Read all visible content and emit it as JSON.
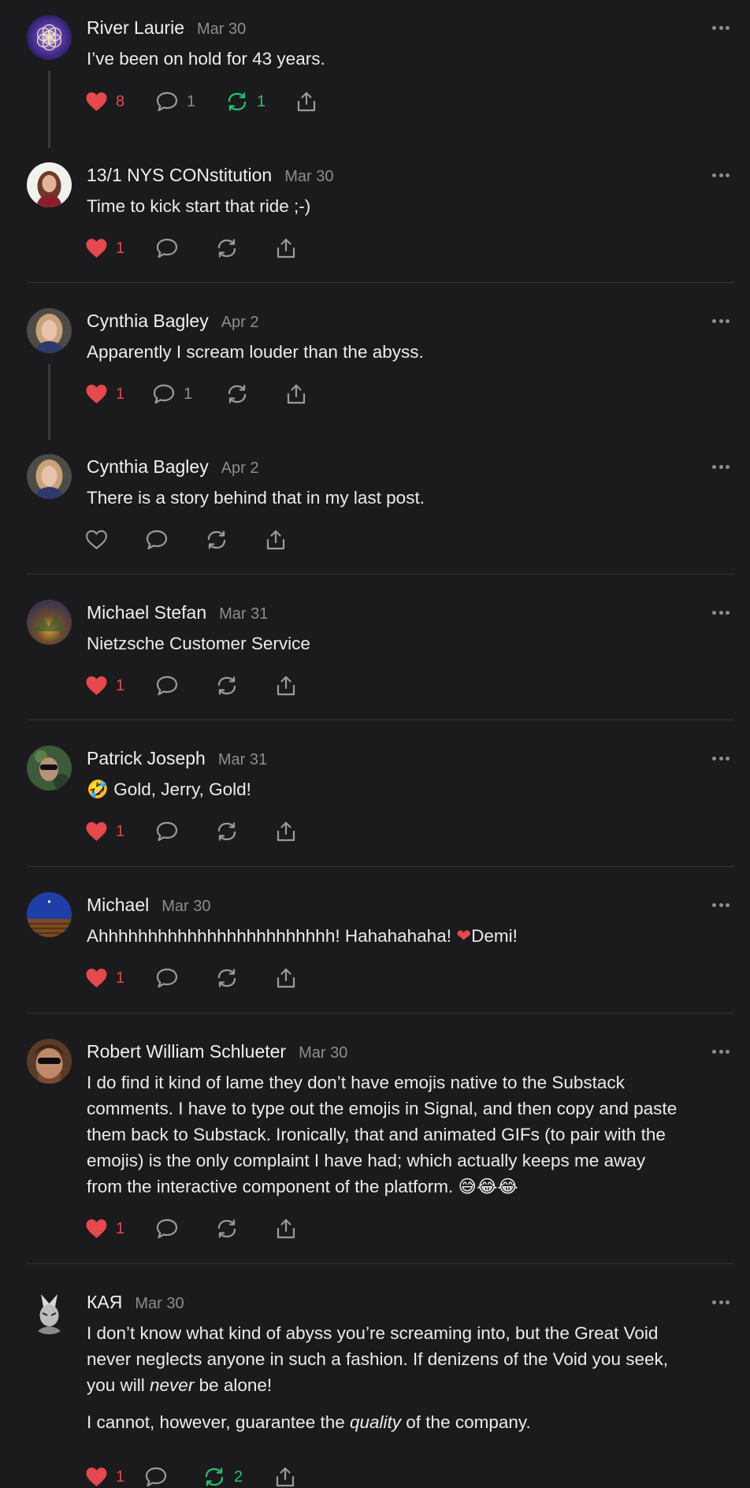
{
  "colors": {
    "background": "#1b1b1d",
    "like_red": "#e5484d",
    "restack_green": "#29c16e",
    "muted": "#8d8d90",
    "divider": "#333336"
  },
  "comments": [
    {
      "author": "River Laurie",
      "date": "Mar 30",
      "text": "I’ve been on hold for 43 years.",
      "likes": "8",
      "replies": "1",
      "restacks": "1",
      "liked": true,
      "restacked": true
    },
    {
      "author": "13/1 NYS CONstitution",
      "date": "Mar 30",
      "text": "Time to kick start that ride ;-)",
      "likes": "1",
      "liked": true
    },
    {
      "author": "Cynthia Bagley",
      "date": "Apr 2",
      "text": "Apparently I scream louder than the abyss.",
      "likes": "1",
      "replies": "1",
      "liked": true
    },
    {
      "author": "Cynthia Bagley",
      "date": "Apr 2",
      "text": "There is a story behind that in my last post.",
      "liked": false
    },
    {
      "author": "Michael Stefan",
      "date": "Mar 31",
      "text": "Nietzsche Customer Service",
      "likes": "1",
      "liked": true
    },
    {
      "author": "Patrick Joseph",
      "date": "Mar 31",
      "emoji_prefix": "🤣",
      "text": " Gold, Jerry, Gold!",
      "likes": "1",
      "liked": true
    },
    {
      "author": "Michael",
      "date": "Mar 30",
      "text": "Ahhhhhhhhhhhhhhhhhhhhhhhh! Hahahahaha! ",
      "heart_emoji": "❤",
      "text_after": "Demi!",
      "likes": "1",
      "liked": true
    },
    {
      "author": "Robert William Schlueter",
      "date": "Mar 30",
      "text_lines": [
        "I do find it kind of lame they don’t have emojis native to the Substack",
        "comments. I have to type out the emojis in Signal, and then copy and paste",
        "them back to Substack. Ironically, that and animated GIFs (to pair with the",
        "emojis) is the only complaint I have had; which actually keeps me away",
        "from the interactive component of the platform. "
      ],
      "emoji_suffix": "😅😂😂",
      "likes": "1",
      "liked": true
    },
    {
      "author": "КАЯ",
      "date": "Mar 30",
      "para1_lines": [
        "I don’t know what kind of abyss you’re screaming into, but the Great Void",
        "never neglects anyone in such a fashion. If denizens of the Void you seek,"
      ],
      "para1_end_pre": "you will ",
      "para1_end_em": "never",
      "para1_end_post": " be alone!",
      "para2_pre": "I cannot, however, guarantee the ",
      "para2_em": "quality",
      "para2_post": " of the company.",
      "likes": "1",
      "restacks": "2",
      "liked": true,
      "restacked": true
    }
  ]
}
